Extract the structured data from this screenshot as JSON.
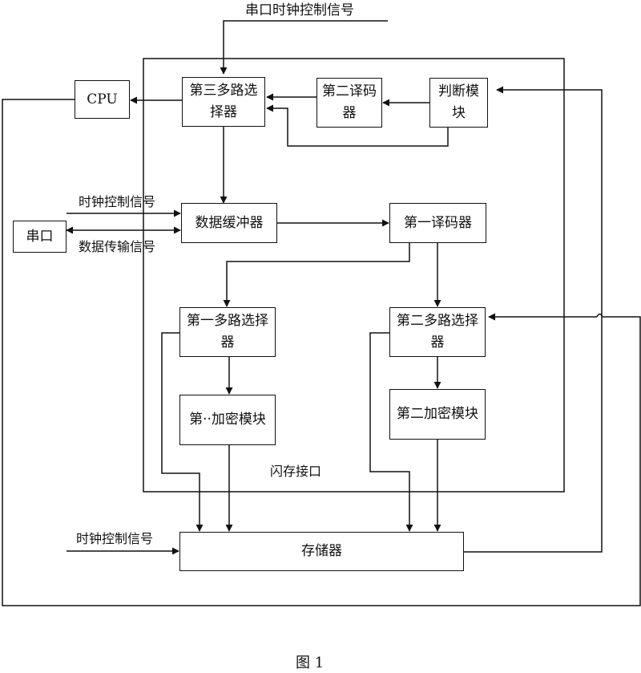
{
  "diagram": {
    "blocks": {
      "cpu": "CPU",
      "serial_port": "串口",
      "mux3": "第三多路选择器",
      "decoder2": "第二译码器",
      "judge": "判断模块",
      "data_buffer": "数据缓冲器",
      "decoder1": "第一译码器",
      "mux1": "第一多路选择器",
      "mux2": "第二多路选择器",
      "encrypt1": "第··加密模块",
      "encrypt2": "第二加密模块",
      "memory": "存储器"
    },
    "labels": {
      "serial_clock_signal": "串口时钟控制信号",
      "clock_signal_top": "时钟控制信号",
      "data_transfer_signal": "数据传输信号",
      "flash_interface": "闪存接口",
      "clock_signal_bottom": "时钟控制信号"
    },
    "colors": {
      "line": "#111111",
      "background": "#ffffff"
    },
    "caption": "图 1"
  }
}
